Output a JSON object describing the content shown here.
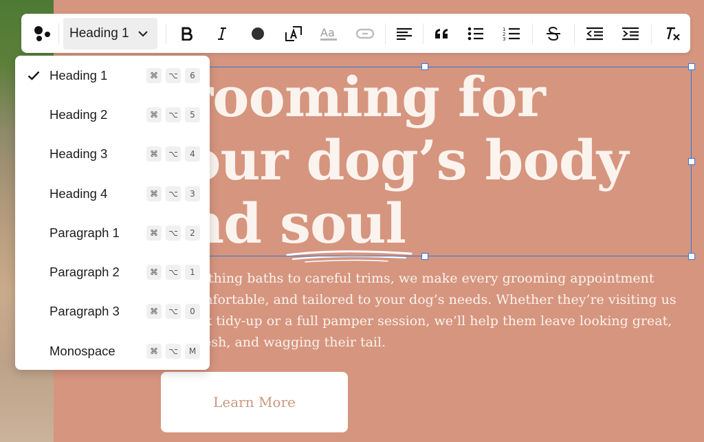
{
  "page": {
    "headline_lines": [
      "rooming for",
      "our dog’s body",
      "nd soul"
    ],
    "body_lines": [
      "oothing baths to careful trims, we make every grooming appointment",
      "omfortable, and tailored to your dog’s needs. Whether they’re visiting us",
      "ick tidy-up or a full pamper session, we’ll help them leave looking great,",
      "fresh, and wagging their tail."
    ],
    "cta_label": "Learn More"
  },
  "toolbar": {
    "style_select_value": "Heading 1",
    "buttons": [
      "logo-icon",
      "bold-icon",
      "italic-icon",
      "text-color-icon",
      "font-size-icon",
      "text-style-icon",
      "link-icon",
      "align-left-icon",
      "blockquote-icon",
      "bullet-list-icon",
      "numbered-list-icon",
      "strikethrough-icon",
      "outdent-icon",
      "indent-icon",
      "clear-format-icon"
    ]
  },
  "menu": {
    "items": [
      {
        "label": "Heading 1",
        "selected": true,
        "keys": [
          "⌘",
          "⌥",
          "6"
        ]
      },
      {
        "label": "Heading 2",
        "selected": false,
        "keys": [
          "⌘",
          "⌥",
          "5"
        ]
      },
      {
        "label": "Heading 3",
        "selected": false,
        "keys": [
          "⌘",
          "⌥",
          "4"
        ]
      },
      {
        "label": "Heading 4",
        "selected": false,
        "keys": [
          "⌘",
          "⌥",
          "3"
        ]
      },
      {
        "label": "Paragraph 1",
        "selected": false,
        "keys": [
          "⌘",
          "⌥",
          "2"
        ]
      },
      {
        "label": "Paragraph 2",
        "selected": false,
        "keys": [
          "⌘",
          "⌥",
          "1"
        ]
      },
      {
        "label": "Paragraph 3",
        "selected": false,
        "keys": [
          "⌘",
          "⌥",
          "0"
        ]
      },
      {
        "label": "Monospace",
        "selected": false,
        "keys": [
          "⌘",
          "⌥",
          "M"
        ]
      }
    ]
  },
  "colors": {
    "background": "#d6957e",
    "selection": "#2f78e5",
    "text_light": "#fbf3ee",
    "cta_text": "#c9997f"
  }
}
